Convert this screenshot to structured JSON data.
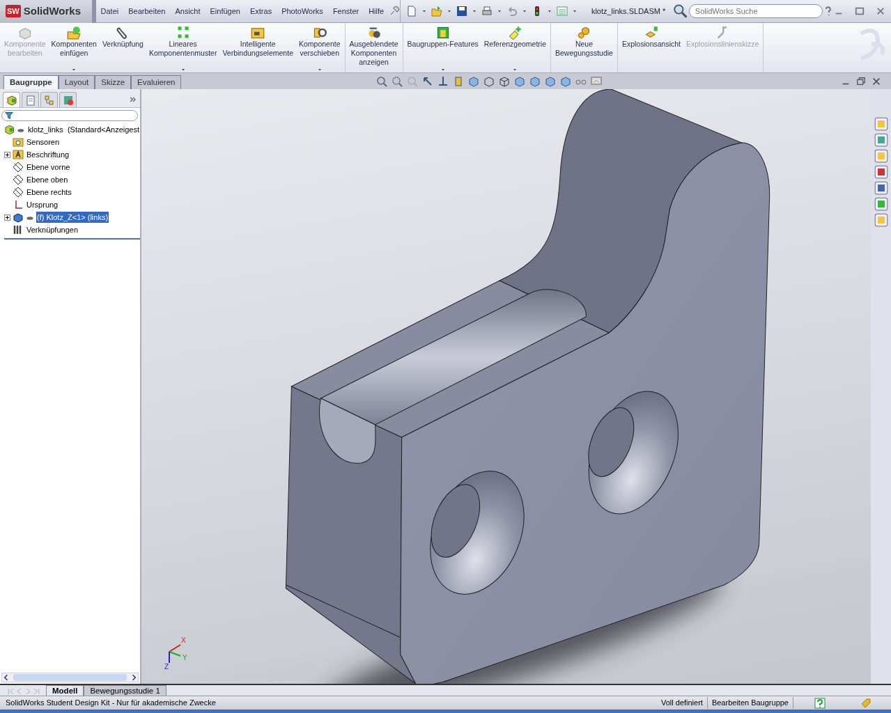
{
  "app": {
    "logo_badge": "SW",
    "logo_text_bold": "Solid",
    "logo_text": "Works"
  },
  "menu": [
    "Datei",
    "Bearbeiten",
    "Ansicht",
    "Einfügen",
    "Extras",
    "PhotoWorks",
    "Fenster",
    "Hilfe"
  ],
  "document_title": "klotz_links.SLDASM *",
  "search": {
    "placeholder": "SolidWorks Suche"
  },
  "ribbon": {
    "groups": [
      [
        {
          "label": "Komponente\nbearbeiten",
          "kind": "edit",
          "disabled": true,
          "dropdown": false
        },
        {
          "label": "Komponenten\neinfügen",
          "kind": "insert",
          "disabled": false,
          "dropdown": true
        },
        {
          "label": "Verknüpfung",
          "kind": "mate",
          "disabled": false,
          "dropdown": false
        },
        {
          "label": "Lineares\nKomponentenmuster",
          "kind": "pattern",
          "disabled": false,
          "dropdown": true
        },
        {
          "label": "Intelligente\nVerbindungselemente",
          "kind": "fastener",
          "disabled": false,
          "dropdown": false
        },
        {
          "label": "Komponente\nverschieben",
          "kind": "move",
          "disabled": false,
          "dropdown": true
        }
      ],
      [
        {
          "label": "Ausgeblendete\nKomponenten\nanzeigen",
          "kind": "show",
          "disabled": false,
          "dropdown": false
        }
      ],
      [
        {
          "label": "Baugruppen-Features",
          "kind": "feature",
          "disabled": false,
          "dropdown": true
        },
        {
          "label": "Referenzgeometrie",
          "kind": "refgeom",
          "disabled": false,
          "dropdown": true
        }
      ],
      [
        {
          "label": "Neue\nBewegungsstudie",
          "kind": "motion",
          "disabled": false,
          "dropdown": false
        }
      ],
      [
        {
          "label": "Explosionsansicht",
          "kind": "explode",
          "disabled": false,
          "dropdown": false
        },
        {
          "label": "Explosionslinienskizze",
          "kind": "explodesketch",
          "disabled": true,
          "dropdown": false
        }
      ]
    ]
  },
  "command_tabs": [
    {
      "label": "Baugruppe",
      "selected": true
    },
    {
      "label": "Layout",
      "selected": false
    },
    {
      "label": "Skizze",
      "selected": false
    },
    {
      "label": "Evaluieren",
      "selected": false
    }
  ],
  "panel_tabs": [
    {
      "kind": "tree",
      "selected": true
    },
    {
      "kind": "properties",
      "selected": false
    },
    {
      "kind": "config",
      "selected": false
    },
    {
      "kind": "display",
      "selected": false
    }
  ],
  "feature_tree": {
    "root": "klotz_links  (Standard<Anzeigest",
    "children": [
      {
        "label": "Sensoren",
        "kind": "sensor",
        "expandable": false,
        "selected": false
      },
      {
        "label": "Beschriftung",
        "kind": "annotation",
        "expandable": true,
        "selected": false
      },
      {
        "label": "Ebene vorne",
        "kind": "plane",
        "expandable": false,
        "selected": false
      },
      {
        "label": "Ebene oben",
        "kind": "plane",
        "expandable": false,
        "selected": false
      },
      {
        "label": "Ebene rechts",
        "kind": "plane",
        "expandable": false,
        "selected": false
      },
      {
        "label": "Ursprung",
        "kind": "origin",
        "expandable": false,
        "selected": false
      },
      {
        "label": "(f) Klotz_Z<1> (links)",
        "kind": "part",
        "expandable": true,
        "selected": true
      },
      {
        "label": "Verknüpfungen",
        "kind": "mates",
        "expandable": false,
        "selected": false
      }
    ]
  },
  "triad": {
    "labels": [
      "X",
      "Y",
      "Z"
    ]
  },
  "bottom_tabs": [
    {
      "label": "Modell",
      "selected": true
    },
    {
      "label": "Bewegungsstudie 1",
      "selected": false
    }
  ],
  "status_bar": {
    "message": "SolidWorks Student Design Kit - Nur für akademische Zwecke",
    "items": [
      "Voll definiert",
      "Bearbeiten Baugruppe"
    ]
  }
}
